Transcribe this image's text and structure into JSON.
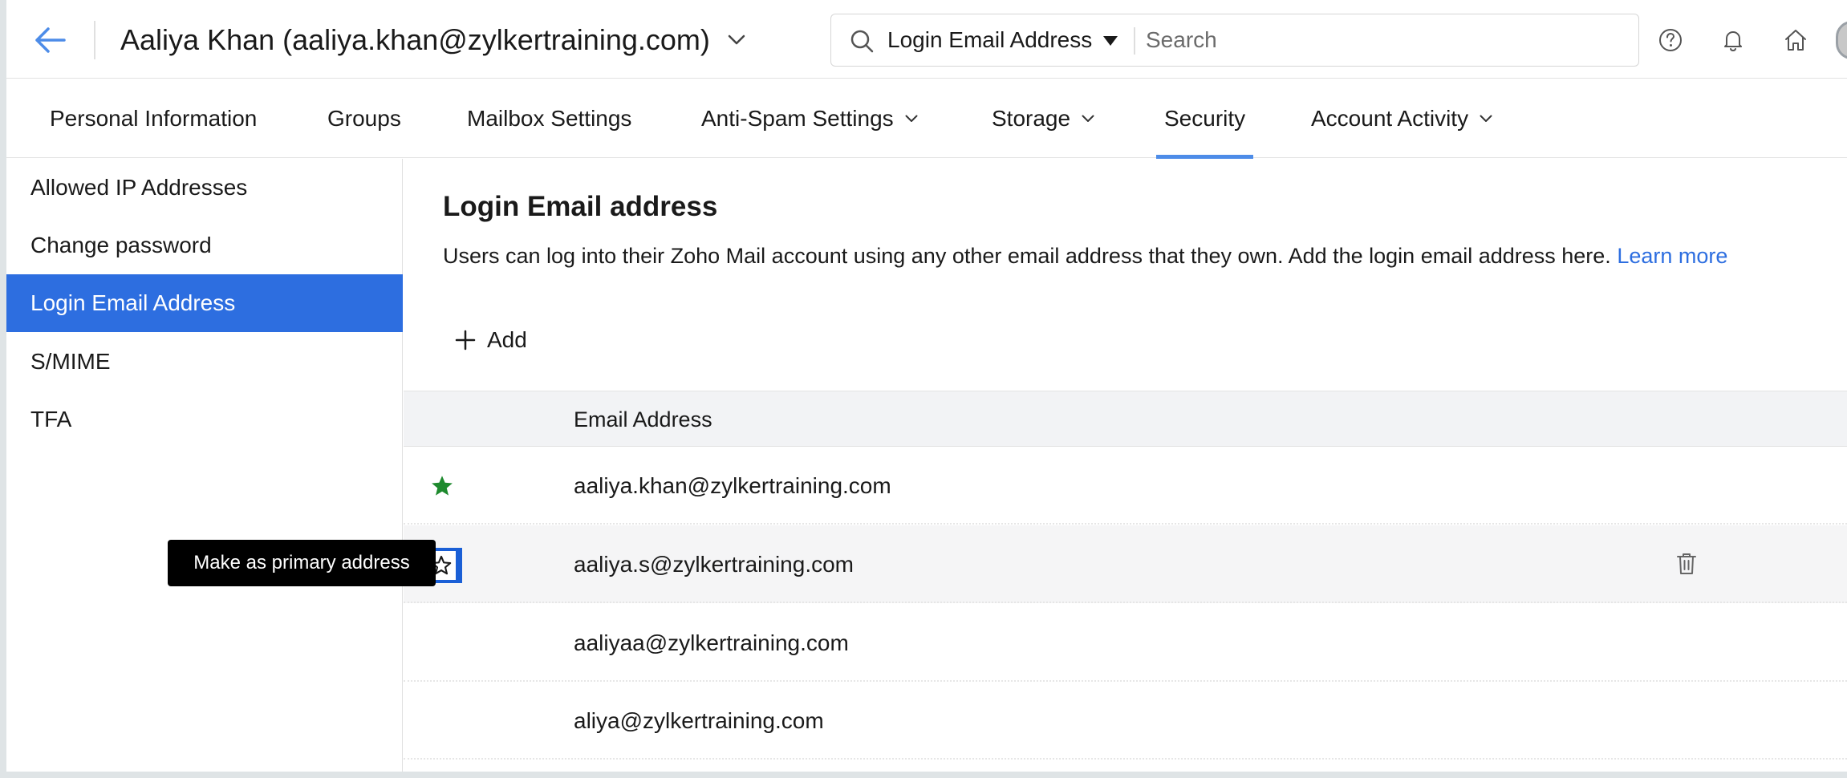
{
  "header": {
    "back_icon": "arrow-left-icon",
    "user_title": "Aaliya Khan (aaliya.khan@zylkertraining.com)",
    "search": {
      "scope": "Login Email Address",
      "placeholder": "Search"
    },
    "icons": [
      "help-icon",
      "bell-icon",
      "home-icon"
    ],
    "accent_color": "#4d8ce8"
  },
  "tabs": [
    {
      "label": "Personal Information",
      "dropdown": false
    },
    {
      "label": "Groups",
      "dropdown": false
    },
    {
      "label": "Mailbox Settings",
      "dropdown": false
    },
    {
      "label": "Anti-Spam Settings",
      "dropdown": true
    },
    {
      "label": "Storage",
      "dropdown": true
    },
    {
      "label": "Security",
      "dropdown": false,
      "active": true
    },
    {
      "label": "Account Activity",
      "dropdown": true
    }
  ],
  "sidebar": {
    "items": [
      {
        "label": "Allowed IP Addresses"
      },
      {
        "label": "Change password"
      },
      {
        "label": "Login Email Address",
        "active": true
      },
      {
        "label": "S/MIME"
      },
      {
        "label": "TFA"
      }
    ],
    "active_color": "#2d6ee0"
  },
  "main": {
    "title": "Login Email address",
    "description": "Users can log into their Zoho Mail account using any other email address that they own. Add the login email address here.",
    "learn_more": "Learn more",
    "add_label": "Add",
    "table": {
      "column_header": "Email Address",
      "rows": [
        {
          "email": "aaliya.khan@zylkertraining.com",
          "primary": true
        },
        {
          "email": "aaliya.s@zylkertraining.com",
          "primary": false,
          "hovered": true
        },
        {
          "email": "aaliyaa@zylkertraining.com",
          "primary": false
        },
        {
          "email": "aliya@zylkertraining.com",
          "primary": false
        }
      ]
    },
    "primary_star_color": "#1e8a2e"
  },
  "tooltip": {
    "text": "Make as primary address"
  }
}
